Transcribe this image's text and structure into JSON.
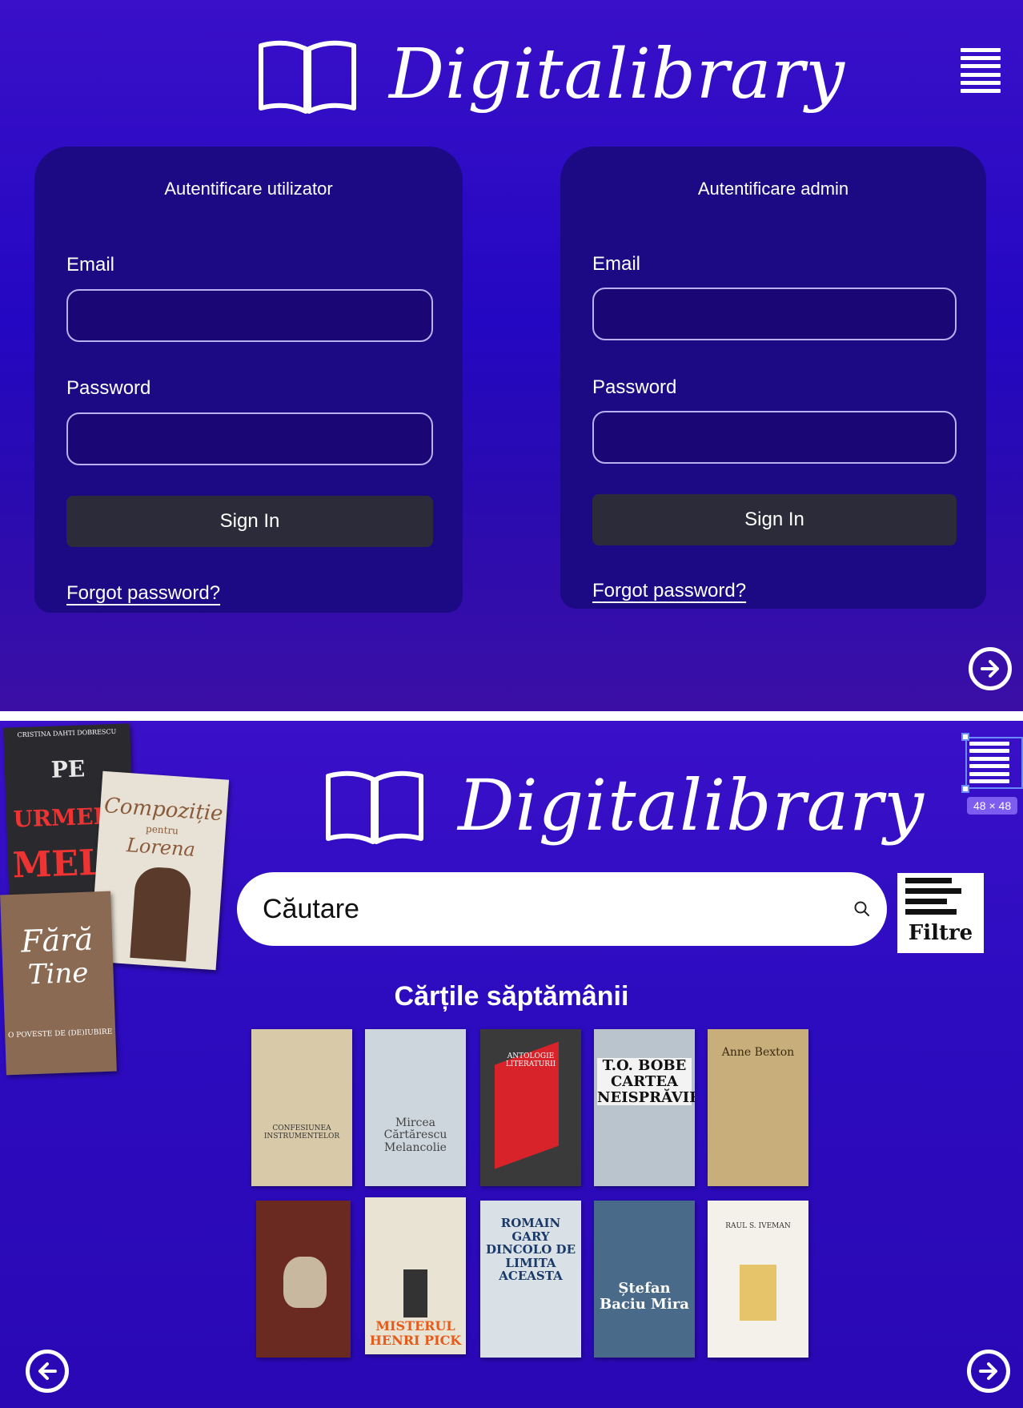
{
  "brand": {
    "name": "Digitalibrary"
  },
  "login": {
    "user_panel": {
      "title": "Autentificare utilizator",
      "email_label": "Email",
      "email_value": "",
      "password_label": "Password",
      "password_value": "",
      "sign_in": "Sign In",
      "forgot": "Forgot password?"
    },
    "admin_panel": {
      "title": "Autentificare admin",
      "email_label": "Email",
      "email_value": "",
      "password_label": "Password",
      "password_value": "",
      "sign_in": "Sign In",
      "forgot": "Forgot password?"
    }
  },
  "selection": {
    "dimensions": "48 × 48"
  },
  "search": {
    "placeholder": "Căutare",
    "filter_label": "Filtre"
  },
  "weekly": {
    "title": "Cărțile săptămânii"
  },
  "side_covers": [
    {
      "lines": [
        "PE",
        "URMELE",
        "MELE"
      ],
      "author": "CRISTINA DAHTI DOBRESCU",
      "bg": "#2a2a2e"
    },
    {
      "lines": [
        "Compoziție",
        "pentru",
        "Lorena"
      ],
      "author": "",
      "bg": "#e8e2d6"
    },
    {
      "lines": [
        "Fără",
        "Tine"
      ],
      "author": "O POVESTE DE (DE)IUBIRE",
      "bg": "#8a6a52"
    }
  ],
  "books": [
    {
      "title": "CONFESIUNEA INSTRUMENTELOR",
      "bg": "#d8c9a8",
      "fg": "#333333"
    },
    {
      "title": "Mircea Cărtărescu Melancolie",
      "bg": "#cdd6dc",
      "fg": "#444444"
    },
    {
      "title": "ANTOLOGIE LITERATURII",
      "bg": "#3a3a3a",
      "fg": "#ffffff"
    },
    {
      "title": "T.O. BOBE CARTEA NEISPRĂVIRII",
      "bg": "#b9c4cc",
      "fg": "#111111"
    },
    {
      "title": "Anne Bexton",
      "bg": "#c7ae7a",
      "fg": "#3a2a10"
    },
    {
      "title": "",
      "bg": "#6a2a22",
      "fg": "#ffffff"
    },
    {
      "title": "MISTERUL HENRI PICK",
      "bg": "#e9e3d4",
      "fg": "#e65a1a"
    },
    {
      "title": "ROMAIN GARY DINCOLO DE LIMITA ACEASTA",
      "bg": "#d9e1e6",
      "fg": "#1a3a6a"
    },
    {
      "title": "Ștefan Baciu Mira",
      "bg": "#4a6a8a",
      "fg": "#ffffff"
    },
    {
      "title": "RAUL S. IVEMAN",
      "bg": "#f4f1ea",
      "fg": "#333333"
    }
  ],
  "colors": {
    "accent": "#2a0bb8",
    "panel": "#1c0a85",
    "button": "#2b2b3a"
  }
}
